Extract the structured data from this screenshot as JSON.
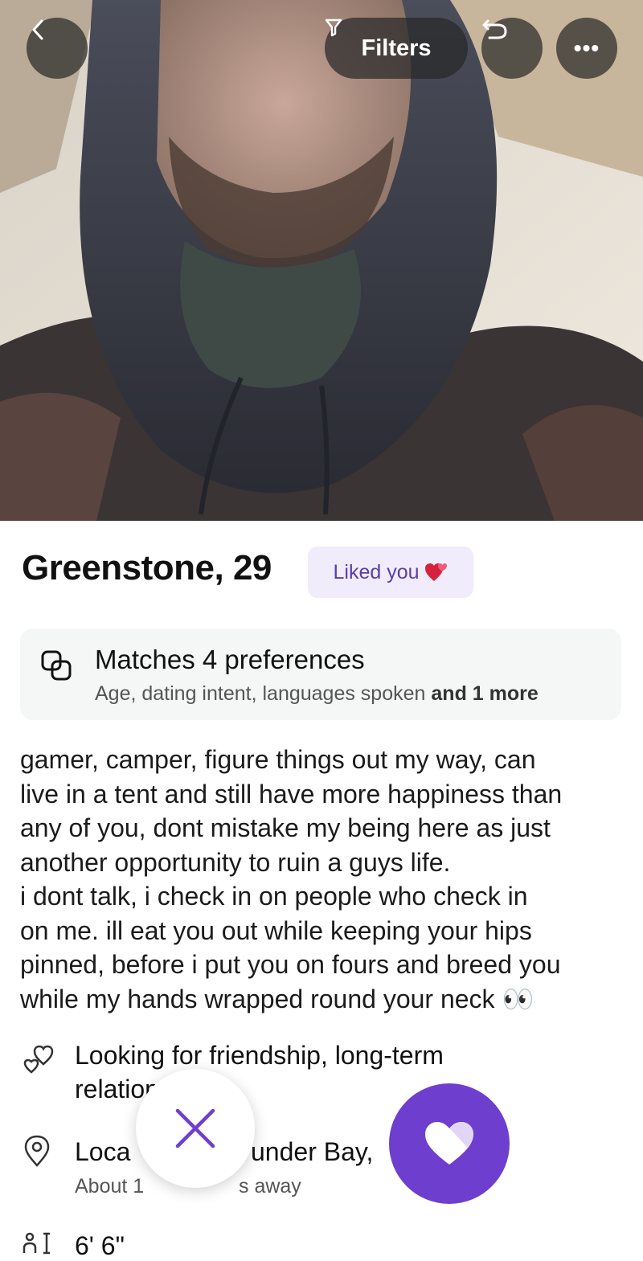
{
  "nav": {
    "filters_label": "Filters",
    "more_label": "•••"
  },
  "profile": {
    "name_age": "Greenstone, 29",
    "liked_badge": "Liked you"
  },
  "matches": {
    "title": "Matches 4 preferences",
    "subtitle": "Age, dating intent, languages spoken",
    "subtitle_more": "and 1 more"
  },
  "bio": {
    "lines": [
      "gamer, camper, figure things out my way, can",
      "live in a tent and still have more happiness than",
      "any of you, dont mistake my being here as just",
      "another opportunity to ruin a guys life.",
      "i dont talk, i check in on people who check in",
      "on me. ill eat you out while keeping your hips",
      "pinned, before i put you on fours and breed you",
      "while my hands wrapped round your neck"
    ],
    "emoji": "👀"
  },
  "details": {
    "looking_for_line1": "Looking for friendship, long-term",
    "looking_for_line2": "relation",
    "location_prefix": "Loca",
    "location_suffix": "under Bay,",
    "distance_prefix": "About 1",
    "distance_suffix": "s away",
    "height": "6' 6\""
  },
  "colors": {
    "accent": "#6e3fce",
    "badge_bg": "#f0ecfb",
    "card_bg": "#f5f6f6"
  }
}
